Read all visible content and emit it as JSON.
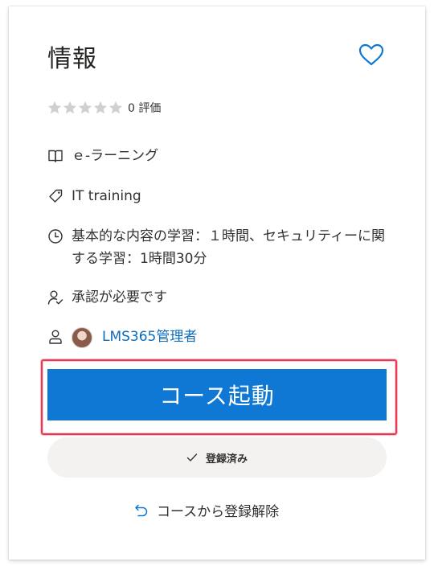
{
  "panel": {
    "title": "情報",
    "favorite_icon": "heart-outline-icon"
  },
  "rating": {
    "stars_filled": 0,
    "stars_total": 5,
    "label": "0 評価"
  },
  "details": {
    "format": {
      "icon": "book-icon",
      "text": "ｅ-ラーニング"
    },
    "category": {
      "icon": "tag-icon",
      "text": "IT training"
    },
    "duration": {
      "icon": "clock-icon",
      "text": "基本的な内容の学習：１時間、セキュリティーに関する学習：1時間30分"
    },
    "approval": {
      "icon": "person-check-icon",
      "text": "承認が必要です"
    },
    "owner": {
      "icon": "person-icon",
      "name": "LMS365管理者"
    }
  },
  "actions": {
    "launch_label": "コース起動",
    "enrolled_label": "登録済み",
    "unenroll_label": "コースから登録解除"
  },
  "colors": {
    "accent": "#0f78d4",
    "link": "#0f6cbd",
    "highlight": "#e63b55",
    "star_empty": "#d2d0ce"
  }
}
